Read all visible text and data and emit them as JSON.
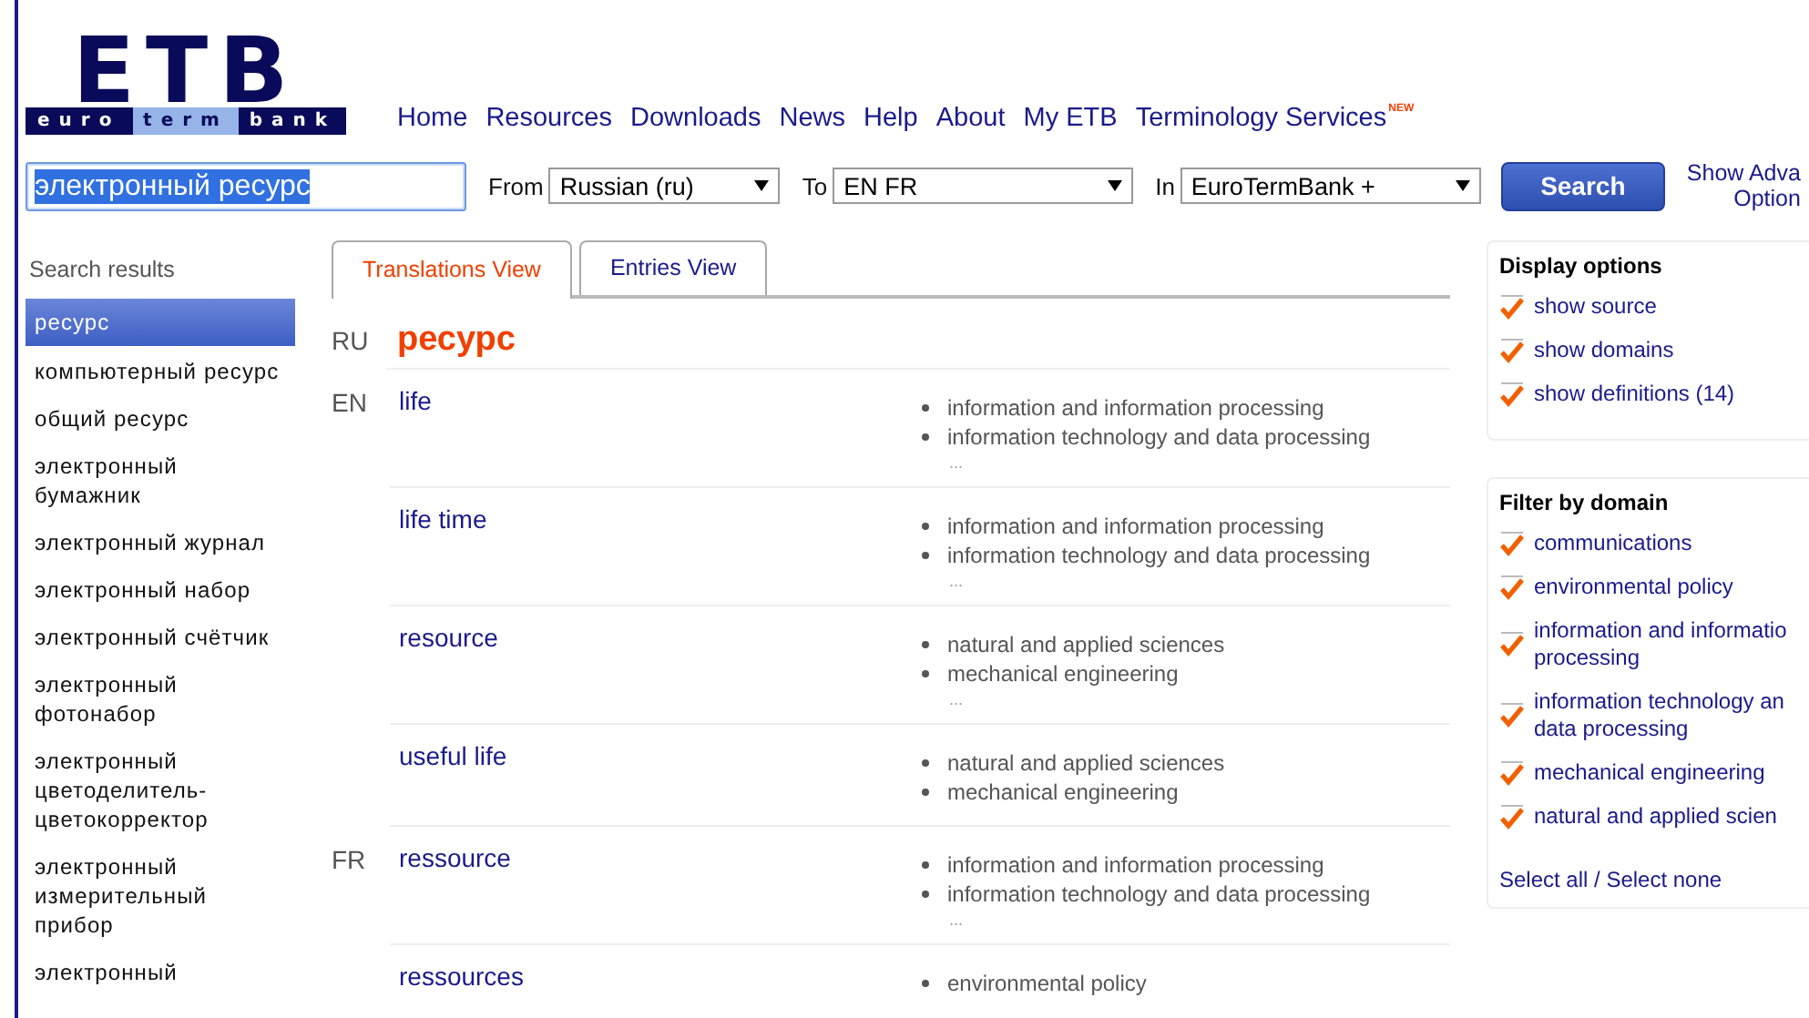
{
  "logo": {
    "mark": "ETB",
    "words": [
      "euro",
      "term",
      "bank"
    ]
  },
  "nav": [
    {
      "label": "Home"
    },
    {
      "label": "Resources"
    },
    {
      "label": "Downloads"
    },
    {
      "label": "News"
    },
    {
      "label": "Help"
    },
    {
      "label": "About"
    },
    {
      "label": "My ETB"
    },
    {
      "label": "Terminology Services",
      "badge": "NEW"
    }
  ],
  "search": {
    "value": "электронный ресурс",
    "from_label": "From",
    "from": "Russian (ru)",
    "to_label": "To",
    "to": "EN FR",
    "in_label": "In",
    "in": "EuroTermBank +",
    "button": "Search",
    "advanced": "Show Adva\nOption"
  },
  "sidebar": {
    "title": "Search results",
    "items": [
      {
        "label": "ресурс",
        "selected": true
      },
      {
        "label": "компьютерный ресурс",
        "selected": false
      },
      {
        "label": "общий ресурс",
        "selected": false
      },
      {
        "label": "электронный бумажник",
        "selected": false
      },
      {
        "label": "электронный журнал",
        "selected": false
      },
      {
        "label": "электронный набор",
        "selected": false
      },
      {
        "label": "электронный счётчик",
        "selected": false
      },
      {
        "label": "электронный фотонабор",
        "selected": false
      },
      {
        "label": "электронный цветоделитель-цветокорректор",
        "selected": false
      },
      {
        "label": "электронный измерительный прибор",
        "selected": false
      },
      {
        "label": "электронный",
        "selected": false
      }
    ]
  },
  "tabs": [
    {
      "label": "Translations View",
      "selected": true
    },
    {
      "label": "Entries View",
      "selected": false
    }
  ],
  "source": {
    "lang": "RU",
    "term": "ресурс"
  },
  "results": [
    {
      "lang": "EN",
      "term": "life",
      "domains": [
        "information and information processing",
        "information technology and data processing"
      ],
      "more": "..."
    },
    {
      "term": "life time",
      "domains": [
        "information and information processing",
        "information technology and data processing"
      ],
      "more": "..."
    },
    {
      "term": "resource",
      "domains": [
        "natural and applied sciences",
        "mechanical engineering"
      ],
      "more": "..."
    },
    {
      "term": "useful life",
      "domains": [
        "natural and applied sciences",
        "mechanical engineering"
      ]
    },
    {
      "lang": "FR",
      "term": "ressource",
      "domains": [
        "information and information processing",
        "information technology and data processing"
      ],
      "more": "..."
    },
    {
      "term": "ressources",
      "domains": [
        "environmental policy"
      ]
    }
  ],
  "display_options": {
    "title": "Display options",
    "items": [
      {
        "label": "show source",
        "checked": true
      },
      {
        "label": "show domains",
        "checked": true
      },
      {
        "label": "show definitions (14)",
        "checked": true
      }
    ]
  },
  "domain_filter": {
    "title": "Filter by domain",
    "items": [
      {
        "label": "communications",
        "checked": true
      },
      {
        "label": "environmental policy",
        "checked": true
      },
      {
        "label": "information and informatio\nprocessing",
        "checked": true
      },
      {
        "label": "information technology an\ndata processing",
        "checked": true
      },
      {
        "label": "mechanical engineering",
        "checked": true
      },
      {
        "label": "natural and applied scien",
        "checked": true
      }
    ],
    "select_all": "Select all / Select none"
  }
}
